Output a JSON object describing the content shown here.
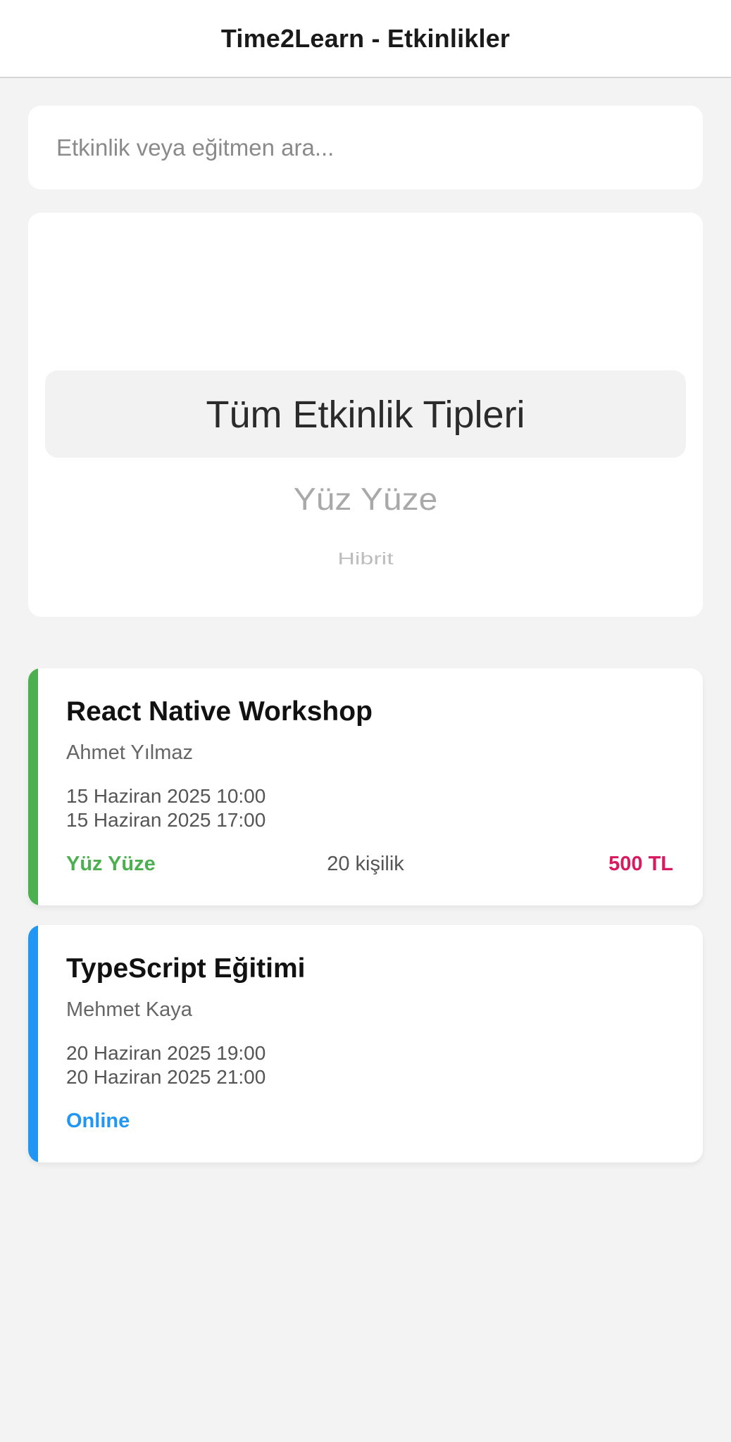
{
  "header": {
    "title": "Time2Learn - Etkinlikler"
  },
  "search": {
    "placeholder": "Etkinlik veya eğitmen ara...",
    "value": ""
  },
  "type_picker": {
    "selected": "Tüm Etkinlik Tipleri",
    "options": [
      "Tüm Etkinlik Tipleri",
      "Yüz Yüze",
      "Hibrit"
    ]
  },
  "events": [
    {
      "title": "React Native Workshop",
      "instructor": "Ahmet Yılmaz",
      "start": "15 Haziran 2025 10:00",
      "end": "15 Haziran 2025 17:00",
      "type": "Yüz Yüze",
      "capacity": "20 kişilik",
      "price": "500 TL",
      "accent_color": "#4caf50",
      "type_color": "#4caf50",
      "price_color": "#d81b60"
    },
    {
      "title": "TypeScript Eğitimi",
      "instructor": "Mehmet Kaya",
      "start": "20 Haziran 2025 19:00",
      "end": "20 Haziran 2025 21:00",
      "type": "Online",
      "accent_color": "#2196f3",
      "type_color": "#2196f3"
    }
  ]
}
